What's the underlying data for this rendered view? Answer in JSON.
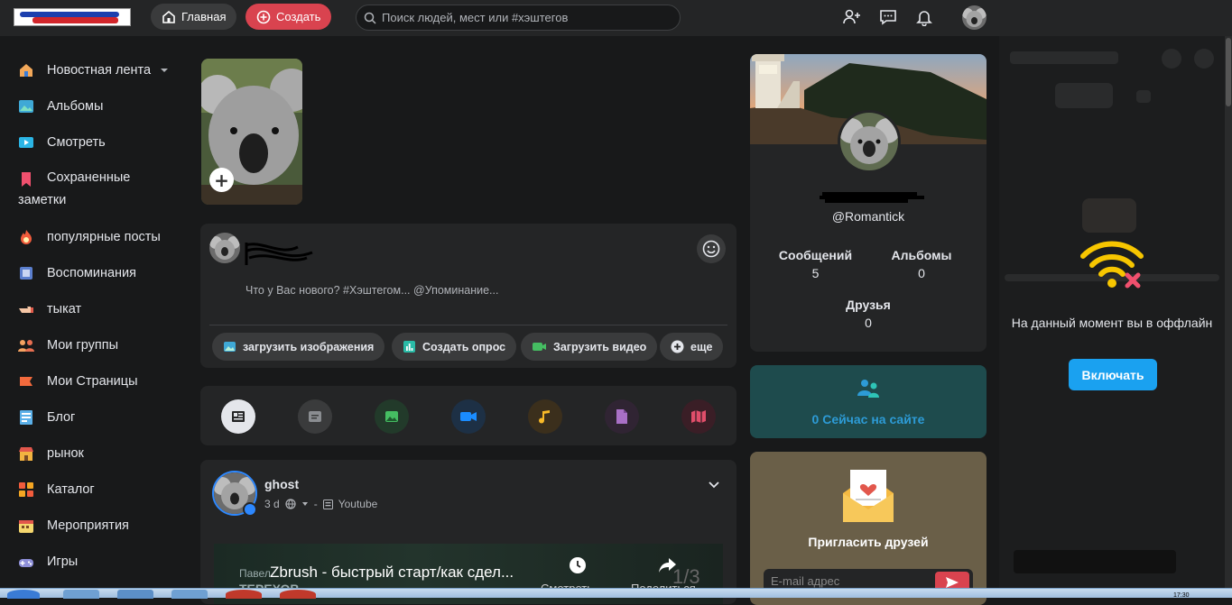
{
  "topbar": {
    "home_label": "Главная",
    "create_label": "Создать",
    "search_placeholder": "Поиск людей, мест или #хэштегов"
  },
  "sidebar": {
    "items": [
      {
        "label": "Новостная лента",
        "icon": "house-icon"
      },
      {
        "label": "Альбомы",
        "icon": "picture-icon"
      },
      {
        "label": "Смотреть",
        "icon": "play-icon"
      },
      {
        "label": "Сохраненные",
        "label2": "заметки",
        "icon": "bookmark-icon"
      },
      {
        "label": "популярные посты",
        "icon": "fire-icon"
      },
      {
        "label": "Воспоминания",
        "icon": "memories-icon"
      },
      {
        "label": "тыкат",
        "icon": "poke-icon"
      },
      {
        "label": "Мои группы",
        "icon": "groups-icon"
      },
      {
        "label": "Мои Страницы",
        "icon": "flag-icon"
      },
      {
        "label": "Блог",
        "icon": "blog-icon"
      },
      {
        "label": "рынок",
        "icon": "market-icon"
      },
      {
        "label": "Каталог",
        "icon": "catalog-icon"
      },
      {
        "label": "Мероприятия",
        "icon": "calendar-icon"
      },
      {
        "label": "Игры",
        "icon": "gamepad-icon"
      }
    ]
  },
  "composer": {
    "placeholder": "Что у Вас нового? #Хэштегом... @Упоминание...",
    "buttons": [
      {
        "label": "загрузить изображения",
        "color": "#45bd62"
      },
      {
        "label": "Создать опрос",
        "color": "#2abba7"
      },
      {
        "label": "Загрузить видео",
        "color": "#45bd62"
      },
      {
        "label": "еще",
        "color": "#e4e6eb"
      }
    ]
  },
  "post": {
    "author": "ghost",
    "time": "3 d",
    "source": "Youtube",
    "video_title": "Zbrush - быстрый старт/как сдел...",
    "video_channel": "Павел",
    "video_brand": "ТЕРЕХОВ",
    "video_watch": "Смотреть",
    "video_share": "Поделиться",
    "video_page": "1/3"
  },
  "profile": {
    "username": "@Romantick",
    "stats": [
      {
        "label": "Сообщений",
        "value": "5"
      },
      {
        "label": "Альбомы",
        "value": "0"
      },
      {
        "label": "Друзья",
        "value": "0"
      }
    ]
  },
  "online": {
    "text": "0 Сейчас на сайте"
  },
  "invite": {
    "title": "Пригласить друзей",
    "email_placeholder": "E-mail адрес"
  },
  "chat": {
    "offline_text": "На данный момент вы в оффлайн",
    "enable_label": "Включать"
  },
  "taskbar": {
    "clock": "17:30"
  },
  "colors": {
    "bg": "#18191a",
    "card": "#242526",
    "accent_red": "#d9434f",
    "accent_blue": "#1aa1f0",
    "online_bg": "#1e4b4d",
    "invite_bg": "#6a5f48"
  }
}
